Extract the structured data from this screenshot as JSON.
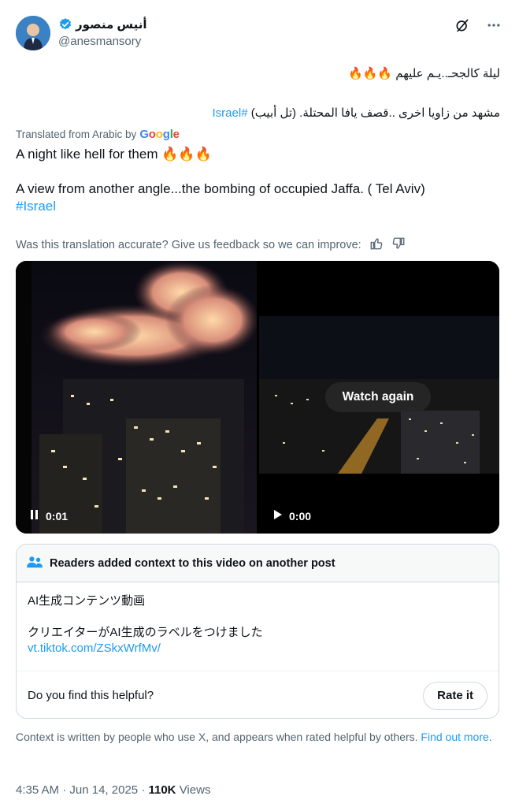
{
  "author": {
    "display_name": "أنيس منصور",
    "handle": "@anesmansory"
  },
  "icons": {
    "verified": "verified-badge-icon",
    "grok": "grok-icon",
    "more": "more-icon",
    "fire": "fire-emoji",
    "thumbs_up": "thumbs-up-icon",
    "thumbs_down": "thumbs-down-icon",
    "pause": "pause-icon",
    "play": "play-icon",
    "people": "people-icon"
  },
  "colors": {
    "accent": "#1d9bf0",
    "text": "#0f1419",
    "muted": "#536471",
    "border": "#cfd9de"
  },
  "original": {
    "line1": "ليلة كالجحـ..يـم عليهم",
    "line1_emoji": "🔥🔥🔥",
    "line2_text": "مشهد من زاويا اخرى ..قصف يافا المحتلة.  (تل أبيب)",
    "line2_hashtag": "#Israel"
  },
  "translation": {
    "label": "Translated from Arabic by",
    "provider": "Google",
    "line1": "A night like hell for them",
    "line1_emoji": "🔥🔥🔥",
    "line2": "A view from another angle...the bombing of occupied Jaffa.  ( Tel Aviv)",
    "hashtag": "#Israel",
    "feedback": "Was this translation accurate? Give us feedback so we can improve:"
  },
  "media": {
    "left_time": "0:01",
    "right_time": "0:00",
    "watch_again": "Watch again"
  },
  "context": {
    "header": "Readers added context to this video on another post",
    "line1": "AI生成コンテンツ動画",
    "line2": "クリエイターがAI生成のラベルをつけました",
    "link": "vt.tiktok.com/ZSkxWrfMv/",
    "helpful_question": "Do you find this helpful?",
    "rate_button": "Rate it",
    "note": "Context is written by people who use X, and appears when rated helpful by others.",
    "find_out_more": "Find out more",
    "note_end": "."
  },
  "meta": {
    "time": "4:35 AM",
    "separator": "·",
    "date": "Jun 14, 2025",
    "views_count": "110K",
    "views_label": "Views"
  }
}
